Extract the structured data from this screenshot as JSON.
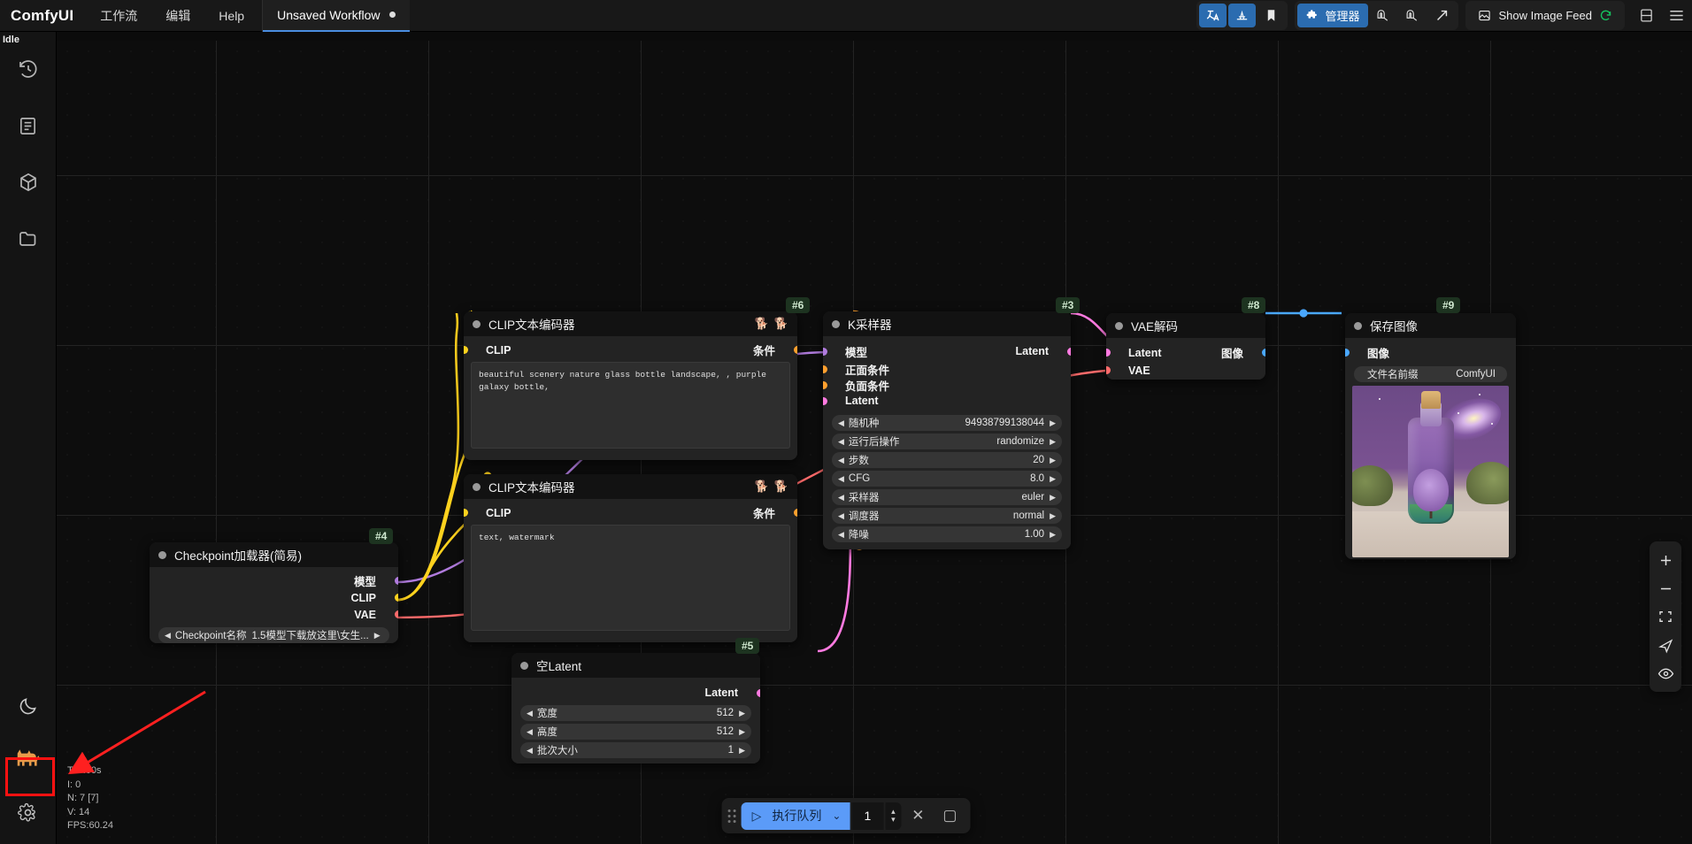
{
  "app": {
    "brand": "ComfyUI",
    "status": "Idle"
  },
  "menu": [
    {
      "label": "工作流",
      "name": "menu-workflow"
    },
    {
      "label": "编辑",
      "name": "menu-edit"
    },
    {
      "label": "Help",
      "name": "menu-help"
    }
  ],
  "workflow_tab": {
    "title": "Unsaved Workflow",
    "modified_dot": "●"
  },
  "toolbar": {
    "translate_icon": "文A",
    "theme_icon": "▲",
    "bookmark_icon": "🔖",
    "manager_label": "管理器",
    "manager_icon": "🧩",
    "magnet_a_icon": "⚗",
    "magnet_b_icon": "⚗",
    "share_icon": "➚",
    "image_feed_label": "Show Image Feed",
    "image_feed_icon": "🖼",
    "refresh_icon": "⟳",
    "panel_icon": "▤",
    "menu_icon": "☰",
    "accent_blue": "#2b6cb0"
  },
  "sidebar": {
    "items": [
      {
        "name": "sidebar-item-queue",
        "icon": "history-icon"
      },
      {
        "name": "sidebar-item-node-library",
        "icon": "book-icon"
      },
      {
        "name": "sidebar-item-model-library",
        "icon": "cube-icon"
      },
      {
        "name": "sidebar-item-workflows",
        "icon": "folder-icon"
      }
    ],
    "bottom": [
      {
        "name": "sidebar-item-theme-toggle",
        "icon": "moon-icon",
        "glyph": "🌙"
      },
      {
        "name": "sidebar-item-dog",
        "icon": "dog-icon",
        "glyph": "🐕"
      },
      {
        "name": "sidebar-item-settings",
        "icon": "gear-icon",
        "glyph": "⚙"
      }
    ]
  },
  "stats": {
    "time": "T: 0.00s",
    "iterations": "I: 0",
    "nodes": "N: 7 [7]",
    "version": "V: 14",
    "fps": "FPS:60.24"
  },
  "bottom_toolbar": {
    "run_label": "执行队列",
    "run_icon": "▷",
    "chevron": "⌄",
    "batch_count": "1",
    "cancel_icon": "✕",
    "stop_icon": "▢"
  },
  "zoom_dock": {
    "zoom_in": "+",
    "zoom_out": "−",
    "fit_view": "⛶",
    "pan": "➤",
    "visibility": "👁"
  },
  "nodes": [
    {
      "id": "clip-positive",
      "badge": "#6",
      "title": "CLIP文本编码器",
      "title_icons": [
        "🐕",
        "🐕"
      ],
      "input_port": "CLIP",
      "output_port": "条件",
      "text": "beautiful scenery nature glass bottle landscape, , purple galaxy bottle,"
    },
    {
      "id": "clip-negative",
      "badge": "",
      "title": "CLIP文本编码器",
      "title_icons": [
        "🐕",
        "🐕"
      ],
      "input_port": "CLIP",
      "output_port": "条件",
      "text": "text, watermark"
    },
    {
      "id": "ksampler",
      "badge": "#3",
      "title": "K采样器",
      "inputs": [
        "模型",
        "正面条件",
        "负面条件",
        "Latent"
      ],
      "outputs": [
        "Latent"
      ],
      "widgets": [
        {
          "label": "随机种",
          "value": "94938799138044"
        },
        {
          "label": "运行后操作",
          "value": "randomize"
        },
        {
          "label": "步数",
          "value": "20"
        },
        {
          "label": "CFG",
          "value": "8.0"
        },
        {
          "label": "采样器",
          "value": "euler"
        },
        {
          "label": "调度器",
          "value": "normal"
        },
        {
          "label": "降噪",
          "value": "1.00"
        }
      ]
    },
    {
      "id": "vae-decode",
      "badge": "#8",
      "title": "VAE解码",
      "inputs": [
        "Latent",
        "VAE"
      ],
      "outputs": [
        "图像"
      ]
    },
    {
      "id": "save-image",
      "badge": "#9",
      "title": "保存图像",
      "inputs": [
        "图像"
      ],
      "widgets": [
        {
          "label": "文件名前缀",
          "value": "ComfyUI"
        }
      ]
    },
    {
      "id": "checkpoint-loader",
      "badge": "#4",
      "title": "Checkpoint加载器(简易)",
      "outputs": [
        "模型",
        "CLIP",
        "VAE"
      ],
      "widgets": [
        {
          "label": "Checkpoint名称",
          "value": "1.5模型下载放这里\\女生..."
        }
      ]
    },
    {
      "id": "empty-latent",
      "badge": "#5",
      "title": "空Latent",
      "outputs": [
        "Latent"
      ],
      "widgets": [
        {
          "label": "宽度",
          "value": "512"
        },
        {
          "label": "高度",
          "value": "512"
        },
        {
          "label": "批次大小",
          "value": "1"
        }
      ]
    }
  ],
  "colors": {
    "port_clip": "#ffd21e",
    "port_model": "#b07bdd",
    "port_vae": "#ff6b6b",
    "port_latent": "#ff7ae0",
    "port_image": "#4aa8ff",
    "port_cond": "#ffa02e",
    "badge_bg": "#1d3320",
    "annotation_arrow": "#ff2020"
  }
}
